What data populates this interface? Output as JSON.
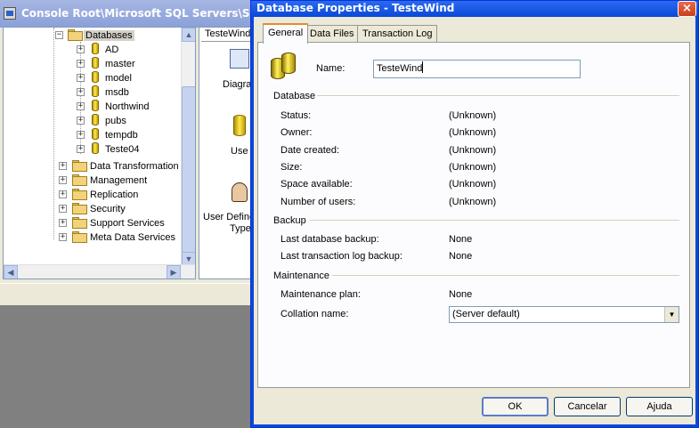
{
  "console": {
    "title": "Console Root\\Microsoft SQL Servers\\SQL Se",
    "tree": {
      "databases_label": "Databases",
      "databases": [
        "AD",
        "master",
        "model",
        "msdb",
        "Northwind",
        "pubs",
        "tempdb",
        "Teste04"
      ],
      "folders": [
        "Data Transformation",
        "Management",
        "Replication",
        "Security",
        "Support Services",
        "Meta Data Services"
      ]
    },
    "right_pane": {
      "tab_label": "TesteWind",
      "items": [
        "Diagra",
        "Use",
        "User Define",
        "Type"
      ]
    }
  },
  "dialog": {
    "title": "Database Properties - TesteWind",
    "tabs": [
      "General",
      "Data Files",
      "Transaction Log"
    ],
    "name_label": "Name:",
    "name_value": "TesteWind",
    "sections": {
      "database": {
        "title": "Database",
        "rows": [
          {
            "label": "Status:",
            "value": "(Unknown)"
          },
          {
            "label": "Owner:",
            "value": "(Unknown)"
          },
          {
            "label": "Date created:",
            "value": "(Unknown)"
          },
          {
            "label": "Size:",
            "value": "(Unknown)"
          },
          {
            "label": "Space available:",
            "value": "(Unknown)"
          },
          {
            "label": "Number of users:",
            "value": "(Unknown)"
          }
        ]
      },
      "backup": {
        "title": "Backup",
        "rows": [
          {
            "label": "Last database backup:",
            "value": "None"
          },
          {
            "label": "Last transaction log backup:",
            "value": "None"
          }
        ]
      },
      "maintenance": {
        "title": "Maintenance",
        "plan_label": "Maintenance plan:",
        "plan_value": "None",
        "collation_label": "Collation name:",
        "collation_value": "(Server default)"
      }
    },
    "buttons": {
      "ok": "OK",
      "cancel": "Cancelar",
      "help": "Ajuda"
    }
  },
  "colors": {
    "title_bar": "#0a48d8",
    "tab_highlight": "#e68b2c",
    "folder": "#f2d37a",
    "database_icon": "#ffe850"
  }
}
